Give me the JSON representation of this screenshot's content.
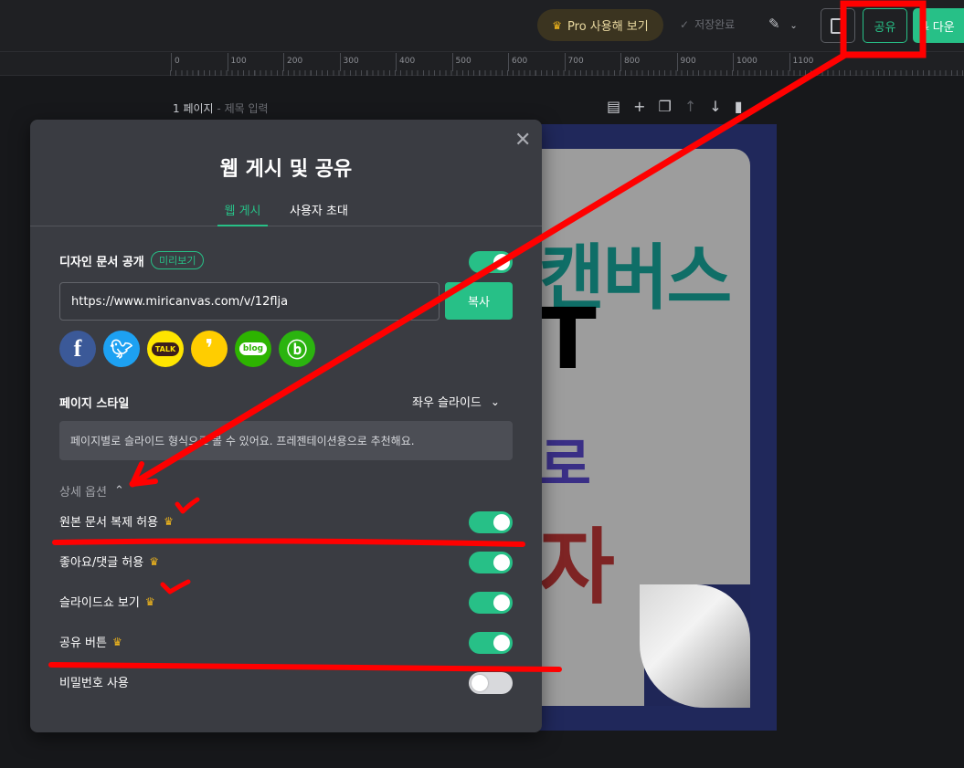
{
  "topbar": {
    "pro_label": "Pro 사용해 보기",
    "saved_label": "저장완료",
    "share_label": "공유",
    "download_label": "다운"
  },
  "ruler": {
    "ticks": [
      "0",
      "100",
      "200",
      "300",
      "400",
      "500",
      "600",
      "700",
      "800",
      "900",
      "1000",
      "1100"
    ]
  },
  "page": {
    "label": "1 페이지",
    "title_placeholder": "제목 입력"
  },
  "canvas": {
    "line1": "캔버스",
    "line2": "T",
    "line3": "로",
    "line4": "자"
  },
  "modal": {
    "title": "웹 게시 및 공유",
    "tabs": [
      "웹 게시",
      "사용자 초대"
    ],
    "publish_label": "디자인 문서 공개",
    "preview_badge": "미리보기",
    "url": "https://www.miricanvas.com/v/12flja",
    "copy_label": "복사",
    "social": {
      "facebook": "f",
      "twitter": "t",
      "kakaotalk": "TALK",
      "kakaostory": "s",
      "blog": "blog",
      "band": "b"
    },
    "page_style_label": "페이지 스타일",
    "page_style_value": "좌우 슬라이드",
    "page_style_info": "페이지별로 슬라이드 형식으로 볼 수 있어요. 프레젠테이션용으로 추천해요.",
    "detail_options_label": "상세 옵션",
    "options": [
      {
        "label": "원본 문서 복제 허용",
        "pro": true,
        "on": true
      },
      {
        "label": "좋아요/댓글 허용",
        "pro": true,
        "on": true
      },
      {
        "label": "슬라이드쇼 보기",
        "pro": true,
        "on": true
      },
      {
        "label": "공유 버튼",
        "pro": true,
        "on": true
      },
      {
        "label": "비밀번호 사용",
        "pro": false,
        "on": false
      }
    ]
  },
  "colors": {
    "accent": "#27c087",
    "annotation": "#ff0000",
    "crown": "#f3b81c"
  }
}
